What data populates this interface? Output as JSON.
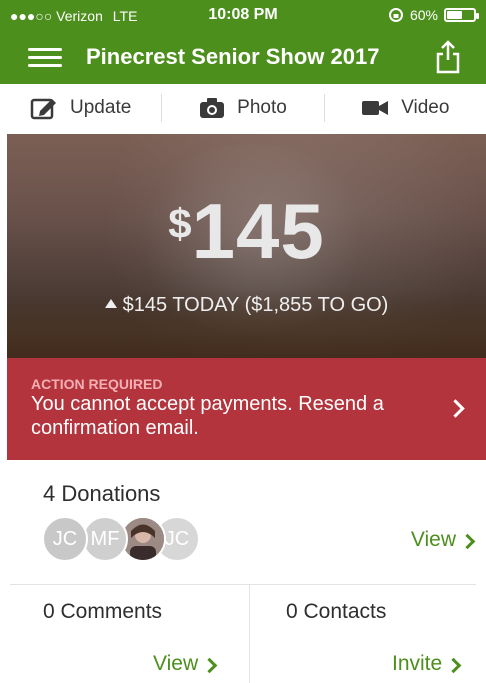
{
  "status_bar": {
    "signal": "●●●○○",
    "carrier": "Verizon",
    "network": "LTE",
    "time": "10:08 PM",
    "battery_percent": "60%",
    "battery_level": 0.6
  },
  "header": {
    "title": "Pinecrest Senior Show 2017",
    "menu_icon": "hamburger-menu-icon",
    "share_icon": "share-icon"
  },
  "actions": [
    {
      "label": "Update",
      "icon": "edit-icon"
    },
    {
      "label": "Photo",
      "icon": "camera-icon"
    },
    {
      "label": "Video",
      "icon": "video-camera-icon"
    }
  ],
  "hero": {
    "currency": "$",
    "amount": "145",
    "today_text": "$145 TODAY ($1,855 TO GO)"
  },
  "alert": {
    "kicker": "ACTION REQUIRED",
    "message": "You cannot accept payments. Resend a confirmation email."
  },
  "donations": {
    "title": "4 Donations",
    "avatars": [
      "JC",
      "MF",
      "",
      "JC"
    ],
    "view_label": "View"
  },
  "comments": {
    "title": "0 Comments",
    "view_label": "View"
  },
  "contacts": {
    "title": "0 Contacts",
    "invite_label": "Invite"
  },
  "colors": {
    "header_green": "#4d8f1d",
    "alert_red": "#b3343c",
    "link_green": "#4d8f1d"
  }
}
